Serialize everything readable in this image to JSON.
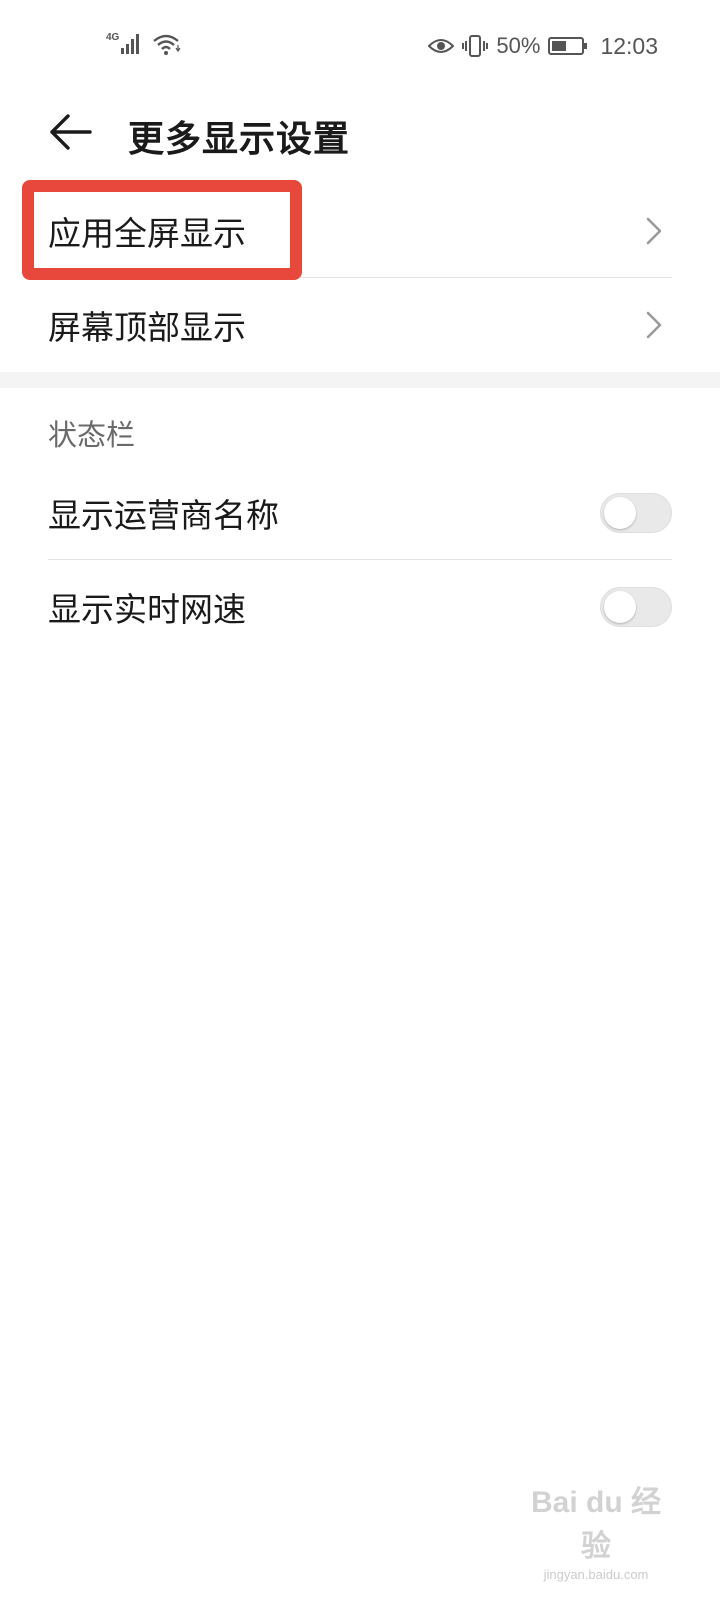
{
  "status_bar": {
    "network_type": "4G",
    "battery_percent": "50%",
    "battery_level": 0.5,
    "time": "12:03",
    "icons": [
      "signal-icon",
      "wifi-icon",
      "eye-icon",
      "vibrate-icon",
      "battery-icon"
    ]
  },
  "header": {
    "title": "更多显示设置"
  },
  "rows": [
    {
      "label": "应用全屏显示",
      "type": "link"
    },
    {
      "label": "屏幕顶部显示",
      "type": "link"
    }
  ],
  "status_section": {
    "header": "状态栏",
    "toggles": [
      {
        "label": "显示运营商名称",
        "on": false
      },
      {
        "label": "显示实时网速",
        "on": false
      }
    ]
  },
  "highlight": {
    "color": "#e8473c",
    "target": "应用全屏显示"
  },
  "watermark": {
    "logo": "Bai du 经验",
    "url": "jingyan.baidu.com"
  }
}
